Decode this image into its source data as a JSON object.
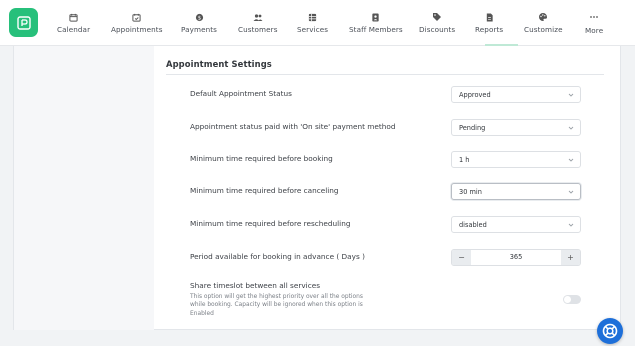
{
  "nav": {
    "items": [
      {
        "label": "Calendar",
        "icon": "calendar-icon"
      },
      {
        "label": "Appointments",
        "icon": "calendar-check-icon"
      },
      {
        "label": "Payments",
        "icon": "dollar-coin-icon"
      },
      {
        "label": "Customers",
        "icon": "users-icon"
      },
      {
        "label": "Services",
        "icon": "grid-list-icon"
      },
      {
        "label": "Staff Members",
        "icon": "id-badge-icon"
      },
      {
        "label": "Discounts",
        "icon": "tag-icon"
      },
      {
        "label": "Reports",
        "icon": "report-icon"
      },
      {
        "label": "Customize",
        "icon": "palette-icon"
      },
      {
        "label": "More",
        "icon": "dots-icon"
      }
    ]
  },
  "settings": {
    "section_title": "Appointment Settings",
    "default_status": {
      "label": "Default Appointment Status",
      "value": "Approved"
    },
    "onsite_status": {
      "label": "Appointment status paid with 'On site' payment method",
      "value": "Pending"
    },
    "min_before_booking": {
      "label": "Minimum time required before booking",
      "value": "1 h"
    },
    "min_before_canceling": {
      "label": "Minimum time required before canceling",
      "value": "30 min"
    },
    "min_before_rescheduling": {
      "label": "Minimum time required before rescheduling",
      "value": "disabled"
    },
    "advance_period": {
      "label": "Period available for booking in advance ( Days )",
      "value": "365",
      "minus": "−",
      "plus": "+"
    },
    "share_timeslot": {
      "title": "Share timeslot between all services",
      "description": "This option will get the highest priority over all the options while booking. Capacity will be ignored when this option is Enabled",
      "enabled": false
    }
  },
  "colors": {
    "brand": "#27c07b",
    "help": "#1e6fd9"
  }
}
